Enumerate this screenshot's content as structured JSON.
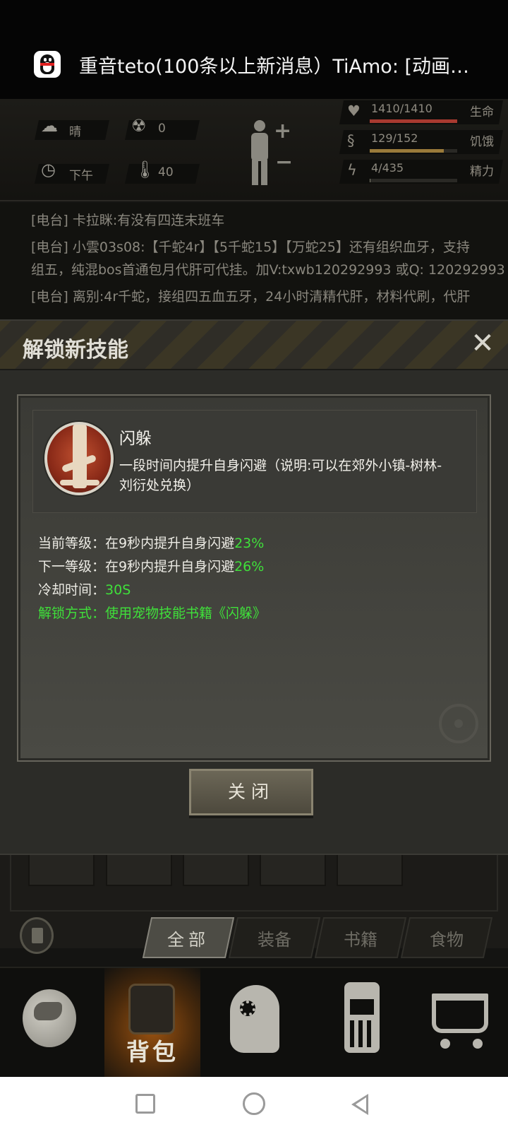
{
  "notification": {
    "text": "重音teto(100条以上新消息）TiAmo: [动画…"
  },
  "status": {
    "weather": "晴",
    "radiation": "0",
    "time_of_day": "下午",
    "temperature": "40",
    "health": {
      "value": "1410/1410",
      "label": "生命",
      "fill": 1.0,
      "color": "#a83a30"
    },
    "hunger": {
      "value": "129/152",
      "label": "饥饿",
      "fill": 0.85,
      "color": "#9a7a3a"
    },
    "energy": {
      "value": "4/435",
      "label": "精力",
      "fill": 0.01,
      "color": "#7a7a6a"
    }
  },
  "chat": {
    "line1": "[电台] 卡拉眯:有没有四连末班车",
    "line2": "[电台] 小雲03s08:【千蛇4r】【5千蛇15】【万蛇25】还有组织血牙，支持",
    "line3": "组五，纯混bos首通包月代肝可代挂。加V:txwb120292993 或Q: 120292993",
    "line4": "[电台] 离别:4r千蛇，接组四五血五牙，24小时清精代肝，材料代刷，代肝"
  },
  "modal": {
    "title": "解锁新技能",
    "close_symbol": "✕",
    "skill_name": "闪躲",
    "skill_desc": "一段时间内提升自身闪避（说明:可以在郊外小镇-树林-刘衍处兑换）",
    "current_level_label": "当前等级：在9秒内提升自身闪避",
    "current_level_value": "23%",
    "next_level_label": "下一等级：在9秒内提升自身闪避",
    "next_level_value": "26%",
    "cooldown_label": "冷却时间：",
    "cooldown_value": "30S",
    "unlock_method": "解锁方式：使用宠物技能书籍《闪躲》",
    "close_button": "关闭"
  },
  "inventory_tabs": [
    "全部",
    "装备",
    "书籍",
    "食物"
  ],
  "bottom_nav": {
    "active_label": "背包"
  }
}
